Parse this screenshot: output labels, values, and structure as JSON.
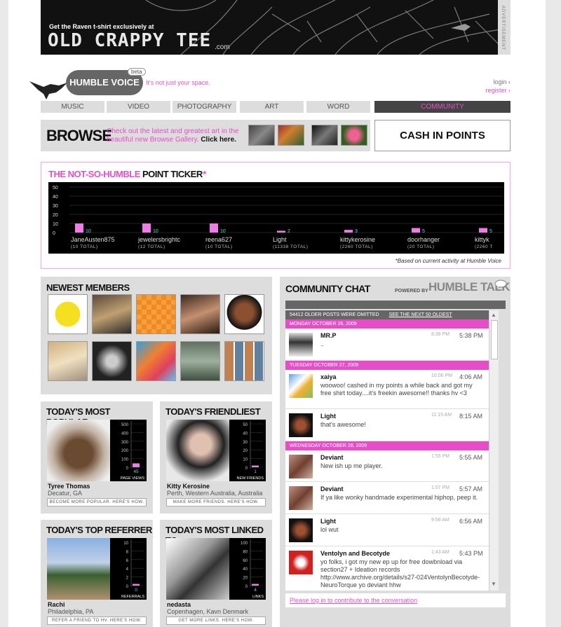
{
  "banner": {
    "line1": "Get the Raven t-shirt exclusively at",
    "brand": "OLD CRAPPY TEE",
    "domain": ".com",
    "side_label": "ADVERTISEMENT"
  },
  "logo": {
    "name": "HUMBLE VOICE",
    "badge": "beta",
    "tagline": "It's not just your space."
  },
  "account": {
    "login": "login ‹",
    "register": "register ‹"
  },
  "nav": [
    "MUSIC",
    "VIDEO",
    "PHOTOGRAPHY",
    "ART",
    "WORD",
    "COMMUNITY"
  ],
  "browse": {
    "title": "BROWSE",
    "desc": "Check out the latest and greatest art in the beautiful new Browse Gallery.",
    "cta": "Click here."
  },
  "cash_in": "CASH IN POINTS",
  "ticker": {
    "title_pink": "THE NOT-SO-HUMBLE",
    "title_dark": "POINT TICKER",
    "star": "*",
    "note": "*Based on current activity at Humble Voice"
  },
  "chart_data": {
    "type": "bar",
    "ylim": [
      0,
      50
    ],
    "yticks": [
      0,
      10,
      20,
      30,
      40,
      50
    ],
    "categories": [
      "JaneAusten875",
      "jewelersbrightc",
      "reena627",
      "Light",
      "kittykerosine",
      "doorhanger",
      "kittyk"
    ],
    "values": [
      10,
      10,
      10,
      2,
      3,
      5,
      5
    ],
    "totals": [
      "(10 TOTAL)",
      "(12 TOTAL)",
      "(10 TOTAL)",
      "(11338 TOTAL)",
      "(2260 TOTAL)",
      "(20 TOTAL)",
      "(2260 T"
    ],
    "bar_color": "#f07ae6",
    "grid": true
  },
  "newest": {
    "title": "NEWEST MEMBERS"
  },
  "popular": {
    "title": "TODAY'S MOST POPULAR",
    "name": "Tyree Thomas",
    "loc": "Decatur, GA",
    "btn": "BECOME MORE POPULAR. HERE'S HOW.",
    "label": "PAGE VIEWS",
    "value": 45,
    "ticks": [
      500,
      400,
      300,
      200,
      100,
      0
    ]
  },
  "friendliest": {
    "title": "TODAY'S FRIENDLIEST",
    "name": "Kitty Kerosine",
    "loc": "Perth, Western Australia, Australia",
    "btn": "MAKE MORE FRIENDS. HERE'S HOW.",
    "label": "NEW FRIENDS",
    "value": 1,
    "ticks": [
      50,
      40,
      30,
      20,
      10,
      0
    ]
  },
  "referrer": {
    "title": "TODAY'S TOP REFERRER",
    "name": "Rachi",
    "loc": "Philadelphia, PA",
    "btn": "REFER A FRIEND TO HV. HERE'S HOW.",
    "label": "REFERRALS",
    "value": 0,
    "ticks": [
      10,
      8,
      6,
      4,
      2,
      0
    ]
  },
  "linked": {
    "title": "TODAY'S MOST LINKED TO",
    "name": "nedasta",
    "loc": "Copenhagen, Kavn  Denmark",
    "btn": "GET MORE LINKS. HERE'S HOW.",
    "label": "LINKS",
    "value": 4,
    "ticks": [
      100,
      80,
      60,
      40,
      20,
      0
    ]
  },
  "chat": {
    "title": "COMMUNITY CHAT",
    "powered": "POWERED BY",
    "brand": "HUMBLE TALK",
    "omitted": "54412 OLDER POSTS WERE OMITTED",
    "next": "SEE THE NEXT 50 OLDEST",
    "day1": "MONDAY OCTOBER 26, 2009",
    "day2": "TUESDAY OCTOBER 27, 2009",
    "day3": "WEDNESDAY OCTOBER 28, 2009",
    "posts": [
      {
        "user": "MR.P",
        "t1": "8:38 PM",
        "t2": "5:38 PM",
        "msg": ".."
      },
      {
        "user": "xaiya",
        "t1": "10:06 PM",
        "t2": "4:06 AM",
        "msg": "woowoo! cashed in my points a while back and got my free shirt today....it's freekin awesome!! thanks hv <3"
      },
      {
        "user": "Light",
        "t1": "11:15 AM",
        "t2": "8:15 AM",
        "msg": "that's awesome!"
      },
      {
        "user": "Deviant",
        "t1": "1:55 PM",
        "t2": "5:55 AM",
        "msg": "New ish up me player."
      },
      {
        "user": "Deviant",
        "t1": "1:57 PM",
        "t2": "5:57 AM",
        "msg": "If ya like wonky handmade experimental hiphop, peep it."
      },
      {
        "user": "Light",
        "t1": "9:56 AM",
        "t2": "6:56 AM",
        "msg": "lol wut"
      },
      {
        "user": "Ventolyn and Becotyde",
        "t1": "1:43 AM",
        "t2": "5:43 PM",
        "msg": "yo folks, i got my new ep up for free dowbnload via section27 + Ideation records http://www.archive.org/details/s27-024VentolynBecotyde-NeuroTorque yo deviant hhw"
      }
    ],
    "login_prompt": "Please log in to contribute to the conversation"
  }
}
